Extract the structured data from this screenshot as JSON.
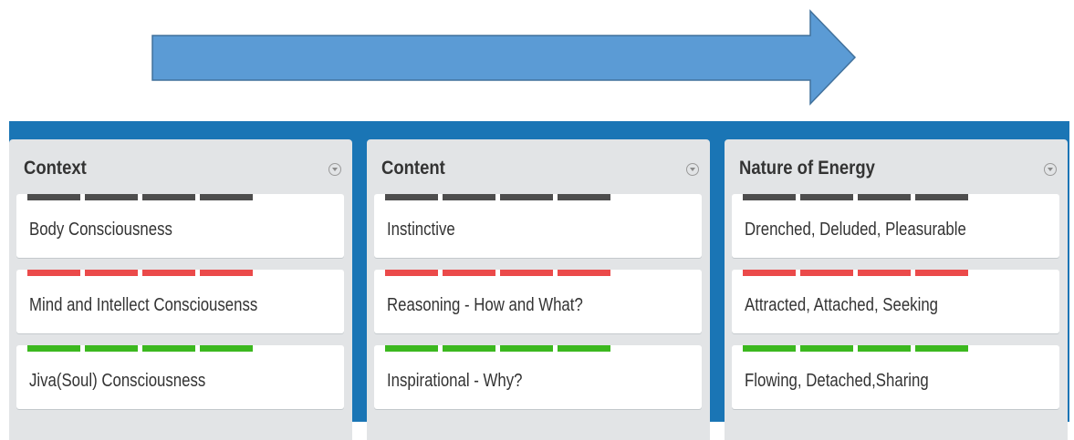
{
  "colors": {
    "board_background": "#1a75b5",
    "list_background": "#e2e4e6",
    "arrow_fill": "#5b9bd5",
    "arrow_stroke": "#41719c",
    "label_dark": "#4d4d4d",
    "label_red": "#eb4a4a",
    "label_green": "#3cb81f"
  },
  "board": {
    "lists": [
      {
        "title": "Context",
        "cards": [
          {
            "text": "Body Consciousness",
            "label_color": "dark"
          },
          {
            "text": "Mind and Intellect Consciousenss",
            "label_color": "red"
          },
          {
            "text": "Jiva(Soul) Consciousness",
            "label_color": "green"
          }
        ]
      },
      {
        "title": "Content",
        "cards": [
          {
            "text": "Instinctive",
            "label_color": "dark"
          },
          {
            "text": "Reasoning - How and What?",
            "label_color": "red"
          },
          {
            "text": "Inspirational - Why?",
            "label_color": "green"
          }
        ]
      },
      {
        "title": "Nature of Energy",
        "cards": [
          {
            "text": "Drenched, Deluded, Pleasurable",
            "label_color": "dark"
          },
          {
            "text": "Attracted, Attached, Seeking",
            "label_color": "red"
          },
          {
            "text": "Flowing, Detached,Sharing",
            "label_color": "green"
          }
        ]
      }
    ]
  }
}
